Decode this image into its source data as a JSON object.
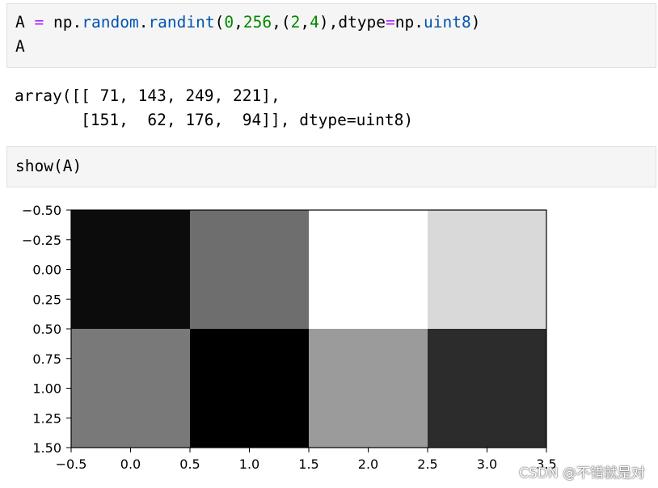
{
  "cells": {
    "input1": {
      "line1": {
        "var": "A",
        "op": "=",
        "mod1": "np",
        "dot1": ".",
        "fn1": "random",
        "dot2": ".",
        "fn2": "randint",
        "open1": "(",
        "n0": "0",
        "comma1": ",",
        "n256": "256",
        "comma2": ",(",
        "n2": "2",
        "comma3": ",",
        "n4": "4",
        "close1": "),",
        "kw": "dtype",
        "eq": "=",
        "mod2": "np",
        "dot3": ".",
        "type": "uint8",
        "close2": ")"
      },
      "line2": "A"
    },
    "output1": {
      "line1": "array([[ 71, 143, 249, 221],",
      "line2": "       [151,  62, 176,  94]], dtype=uint8)"
    },
    "input2": {
      "line1": "show(A)"
    }
  },
  "chart_data": {
    "type": "heatmap",
    "colormap": "gray",
    "values": [
      [
        71,
        143,
        249,
        221
      ],
      [
        151,
        62,
        176,
        94
      ]
    ],
    "xlim": [
      -0.5,
      3.5
    ],
    "ylim": [
      1.5,
      -0.5
    ],
    "xticks": [
      "−0.5",
      "0.0",
      "0.5",
      "1.0",
      "1.5",
      "2.0",
      "2.5",
      "3.0",
      "3.5"
    ],
    "yticks": [
      "−0.50",
      "−0.25",
      "0.00",
      "0.25",
      "0.50",
      "0.75",
      "1.00",
      "1.25",
      "1.50"
    ],
    "xtick_values": [
      -0.5,
      0.0,
      0.5,
      1.0,
      1.5,
      2.0,
      2.5,
      3.0,
      3.5
    ],
    "ytick_values": [
      -0.5,
      -0.25,
      0.0,
      0.25,
      0.5,
      0.75,
      1.0,
      1.25,
      1.5
    ]
  },
  "watermark": "CSDN @不错就是对"
}
